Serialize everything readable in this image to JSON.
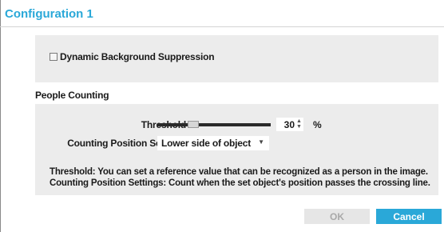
{
  "dialog": {
    "title": "Configuration 1"
  },
  "background": {
    "dynamic_suppression_label": "Dynamic Background Suppression",
    "dynamic_suppression_checked": false
  },
  "people_counting": {
    "section_title": "People Counting",
    "threshold_label": "Threshold",
    "threshold_value": "30",
    "threshold_unit": "%",
    "threshold_slider_fraction": 0.3,
    "position_label": "Counting Position Settings",
    "position_value": "Lower side of object",
    "help_line_1": "Threshold: You can set a reference value that can be recognized as a person in the image.",
    "help_line_2": "Counting Position Settings: Count when the set object's position passes the crossing line."
  },
  "footer": {
    "ok_label": "OK",
    "cancel_label": "Cancel"
  },
  "colors": {
    "accent": "#2aa8d8",
    "panel_bg": "#ececec",
    "disabled_button": "#e6e6e6"
  },
  "icons": {
    "spin_up": "chevron-up-icon",
    "spin_down": "chevron-down-icon",
    "select_arrow": "caret-down-icon"
  }
}
